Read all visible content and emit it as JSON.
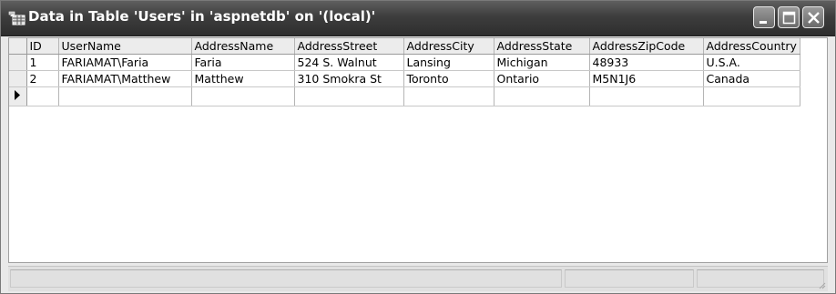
{
  "window": {
    "title": "Data in Table 'Users' in 'aspnetdb' on '(local)'",
    "icon": "table-icon"
  },
  "title_buttons": [
    "minimize-icon",
    "maximize-icon",
    "close-icon"
  ],
  "grid": {
    "columns": [
      "ID",
      "UserName",
      "AddressName",
      "AddressStreet",
      "AddressCity",
      "AddressState",
      "AddressZipCode",
      "AddressCountry"
    ],
    "rows": [
      [
        "1",
        "FARIAMAT\\Faria",
        "Faria",
        "524 S. Walnut",
        "Lansing",
        "Michigan",
        "48933",
        "U.S.A."
      ],
      [
        "2",
        "FARIAMAT\\Matthew",
        "Matthew",
        "310 Smokra St",
        "Toronto",
        "Ontario",
        "M5N1J6",
        "Canada"
      ]
    ],
    "new_row_marker": "arrow-right-icon"
  },
  "status_bar": {}
}
